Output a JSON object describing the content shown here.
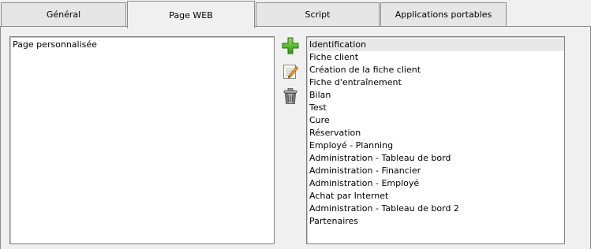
{
  "tabs": [
    {
      "label": "Général",
      "active": false
    },
    {
      "label": "Page WEB",
      "active": true
    },
    {
      "label": "Script",
      "active": false
    },
    {
      "label": "Applications portables",
      "active": false
    }
  ],
  "left_list": {
    "items": [
      "Page personnalisée"
    ]
  },
  "toolbar": {
    "add_icon": "plus-icon",
    "edit_icon": "edit-note-icon",
    "delete_icon": "trash-icon"
  },
  "right_list": {
    "selected_index": 0,
    "items": [
      "Identification",
      "Fiche client",
      "Création de la fiche client",
      "Fiche d'entraînement",
      "Bilan",
      "Test",
      "Cure",
      "Réservation",
      "Employé - Planning",
      "Administration - Tableau de bord",
      "Administration - Financier",
      "Administration - Employé",
      "Achat par Internet",
      "Administration - Tableau de bord 2",
      "Partenaires"
    ]
  }
}
